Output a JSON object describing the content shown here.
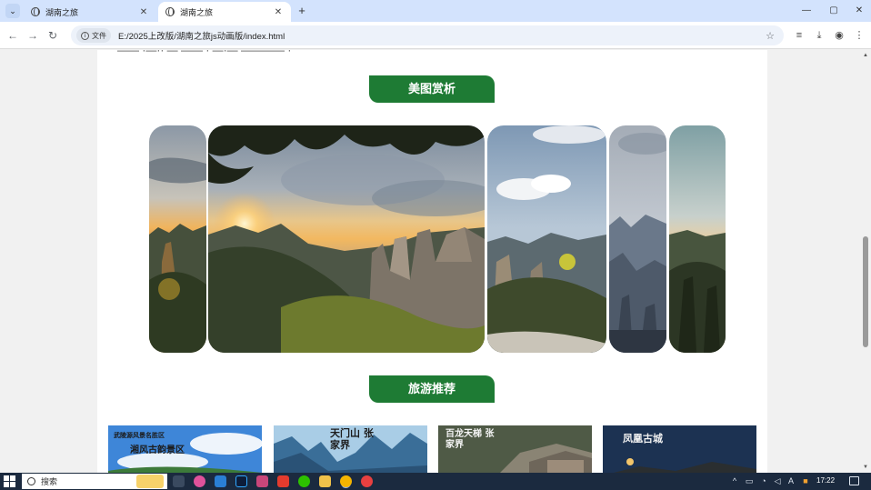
{
  "browser": {
    "tabs": [
      {
        "title": "湖南之旅",
        "active": false
      },
      {
        "title": "湖南之旅",
        "active": true
      }
    ],
    "new_tab": "+",
    "window": {
      "minimize": "—",
      "maximize": "▢",
      "close": "✕"
    },
    "address": {
      "file_label": "文件",
      "url": "E:/2025上改版/湖南之旅js动画版/index.html"
    }
  },
  "page": {
    "cut_off_text": "—— ·—·· — —— · —·— ———— ·",
    "sections": [
      {
        "title": "美图赏析"
      },
      {
        "title": "旅游推荐"
      }
    ],
    "recommendations": [
      {
        "caption": "武陵源风景名胜区",
        "title": "湘风古韵景区"
      },
      {
        "caption": "",
        "title": "天门山 张家界"
      },
      {
        "caption": "",
        "title": "百龙天梯 张家界"
      },
      {
        "caption": "",
        "title": "凤凰古城"
      }
    ]
  },
  "taskbar": {
    "search_placeholder": "搜索",
    "clock": "17:22",
    "ime": "A"
  },
  "colors": {
    "section_green": "#1e7b34",
    "tabstrip": "#d3e3fd",
    "taskbar": "#1b2a3f"
  }
}
